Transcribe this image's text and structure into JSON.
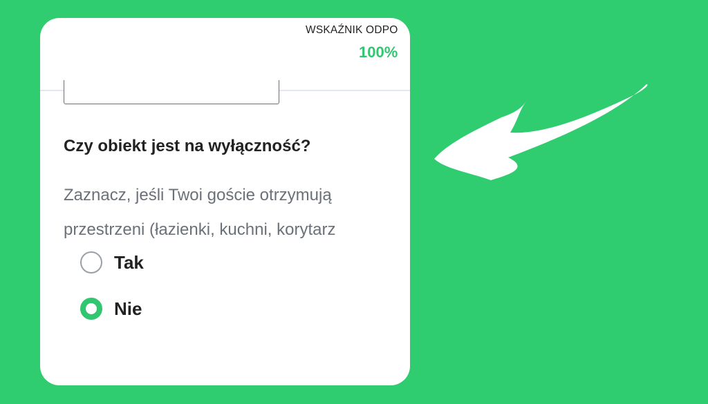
{
  "header": {
    "response_rate_label": "WSKAŹNIK ODPO",
    "response_rate_value": "100%"
  },
  "question": {
    "title": "Czy obiekt jest na wyłączność?",
    "description_line1": "Zaznacz, jeśli Twoi goście otrzymują",
    "description_line2": "przestrzeni (łazienki, kuchni, korytarz"
  },
  "options": [
    {
      "label": "Tak",
      "selected": false
    },
    {
      "label": "Nie",
      "selected": true
    }
  ],
  "colors": {
    "background": "#30cc70",
    "accent": "#32c670",
    "arrow": "#ffffff"
  },
  "decor": {
    "arrow_icon": "hand-drawn-arrow-left-icon"
  }
}
